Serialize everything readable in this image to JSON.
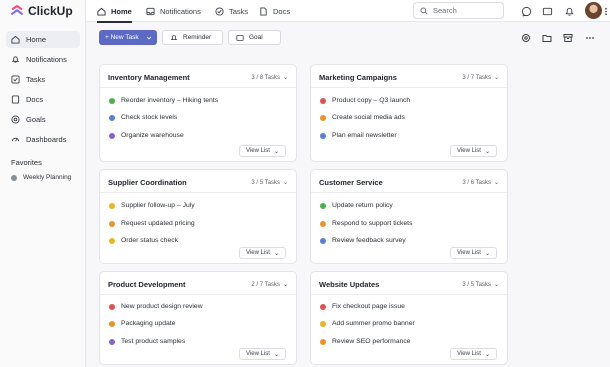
{
  "app": {
    "name": "ClickUp"
  },
  "sidebar": {
    "items": [
      {
        "label": "Home",
        "icon": "home-icon"
      },
      {
        "label": "Notifications",
        "icon": "bell-icon"
      },
      {
        "label": "Tasks",
        "icon": "checkbox-icon"
      },
      {
        "label": "Docs",
        "icon": "doc-icon"
      },
      {
        "label": "Goals",
        "icon": "target-icon"
      },
      {
        "label": "Dashboards",
        "icon": "dashboard-icon"
      }
    ],
    "favorites_title": "Favorites",
    "favorites": [
      {
        "label": "Weekly Planning"
      }
    ]
  },
  "topbar": {
    "tabs": [
      {
        "label": "Home",
        "icon": "home-icon"
      },
      {
        "label": "Notifications",
        "icon": "inbox-icon"
      },
      {
        "label": "Tasks",
        "icon": "tasks-icon"
      },
      {
        "label": "Docs",
        "icon": "doc-icon"
      }
    ],
    "search_placeholder": "Search"
  },
  "actions": {
    "new_task": "+ New Task",
    "reminder": "Reminder",
    "goal": "Goal"
  },
  "colors": {
    "primary": "#5c6ac4",
    "green": "#4caf50",
    "blue": "#5a7fd1",
    "purple": "#8a63c9",
    "red": "#d9534f",
    "orange": "#e8922e",
    "yellow": "#e7b52a"
  },
  "cards": [
    {
      "title": "Inventory Management",
      "count": "3 / 8 Tasks",
      "view": "View List",
      "tasks": [
        {
          "label": "Reorder inventory – Hiking tents",
          "color": "#4caf50"
        },
        {
          "label": "Check stock levels",
          "color": "#5a7fd1"
        },
        {
          "label": "Organize warehouse",
          "color": "#8a63c9"
        }
      ]
    },
    {
      "title": "Marketing Campaigns",
      "count": "3 / 7 Tasks",
      "view": "View List",
      "tasks": [
        {
          "label": "Product copy – Q3 launch",
          "color": "#d9534f"
        },
        {
          "label": "Create social media ads",
          "color": "#e8922e"
        },
        {
          "label": "Plan email newsletter",
          "color": "#5a7fd1"
        }
      ]
    },
    {
      "title": "Supplier Coordination",
      "count": "3 / 5 Tasks",
      "view": "View List",
      "tasks": [
        {
          "label": "Supplier follow-up – July",
          "color": "#e7b52a"
        },
        {
          "label": "Request updated pricing",
          "color": "#e8922e"
        },
        {
          "label": "Order status check",
          "color": "#e7b52a"
        }
      ]
    },
    {
      "title": "Customer Service",
      "count": "3 / 6 Tasks",
      "view": "View List",
      "tasks": [
        {
          "label": "Update return policy",
          "color": "#4caf50"
        },
        {
          "label": "Respond to support tickets",
          "color": "#e8922e"
        },
        {
          "label": "Review feedback survey",
          "color": "#5a7fd1"
        }
      ]
    },
    {
      "title": "Product Development",
      "count": "2 / 7 Tasks",
      "view": "View List",
      "tasks": [
        {
          "label": "New product design review",
          "color": "#d9534f"
        },
        {
          "label": "Packaging update",
          "color": "#e8922e"
        },
        {
          "label": "Test product samples",
          "color": "#8a63c9"
        }
      ]
    },
    {
      "title": "Website Updates",
      "count": "3 / 5 Tasks",
      "view": "View List",
      "tasks": [
        {
          "label": "Fix checkout page issue",
          "color": "#d9534f"
        },
        {
          "label": "Add summer promo banner",
          "color": "#e7b52a"
        },
        {
          "label": "Review SEO performance",
          "color": "#e8922e"
        }
      ]
    }
  ]
}
